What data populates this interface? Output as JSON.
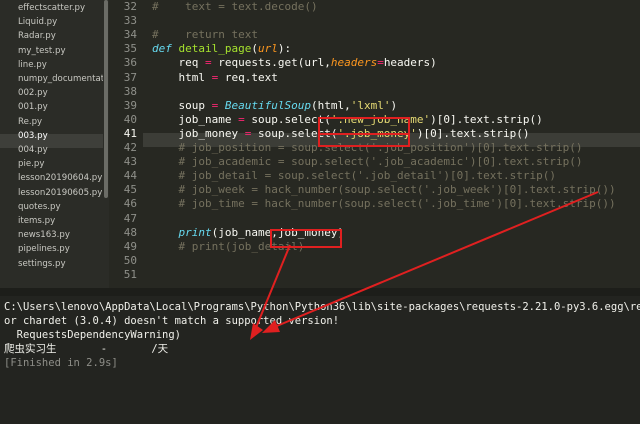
{
  "sidebar": {
    "files": [
      "effectscatter.py",
      "Liquid.py",
      "Radar.py",
      "my_test.py",
      "line.py",
      "numpy_documentatio",
      "002.py",
      "001.py",
      "Re.py",
      "003.py",
      "004.py",
      "pie.py",
      "lesson20190604.py",
      "lesson20190605.py",
      "quotes.py",
      "items.py",
      "news163.py",
      "pipelines.py",
      "settings.py"
    ],
    "selected": "003.py"
  },
  "editor": {
    "current_line": "41",
    "lines": [
      {
        "n": "32",
        "t": "#    text = text.decode()"
      },
      {
        "n": "33",
        "t": ""
      },
      {
        "n": "34",
        "t": "#    return text"
      },
      {
        "n": "35",
        "t": "def detail_page(url):"
      },
      {
        "n": "36",
        "t": "    req = requests.get(url,headers=headers)"
      },
      {
        "n": "37",
        "t": "    html = req.text"
      },
      {
        "n": "38",
        "t": ""
      },
      {
        "n": "39",
        "t": "    soup = BeautifulSoup(html,'lxml')"
      },
      {
        "n": "40",
        "t": "    job_name = soup.select('.new_job_name')[0].text.strip()"
      },
      {
        "n": "41",
        "t": "    job_money = soup.select('.job_money')[0].text.strip()"
      },
      {
        "n": "42",
        "t": "    # job_position = soup.select('.job_position')[0].text.strip()"
      },
      {
        "n": "43",
        "t": "    # job_academic = soup.select('.job_academic')[0].text.strip()"
      },
      {
        "n": "44",
        "t": "    # job_detail = soup.select('.job_detail')[0].text.strip()"
      },
      {
        "n": "45",
        "t": "    # job_week = hack_number(soup.select('.job_week')[0].text.strip())"
      },
      {
        "n": "46",
        "t": "    # job_time = hack_number(soup.select('.job_time')[0].text.strip())"
      },
      {
        "n": "47",
        "t": ""
      },
      {
        "n": "48",
        "t": "    print(job_name,job_money)"
      },
      {
        "n": "49",
        "t": "    # print(job_detail)"
      },
      {
        "n": "50",
        "t": ""
      },
      {
        "n": "51",
        "t": ""
      }
    ]
  },
  "output": {
    "lines": [
      "C:\\Users\\lenovo\\AppData\\Local\\Programs\\Python\\Python36\\lib\\site-packages\\requests-2.21.0-py3.6.egg\\requ",
      "or chardet (3.0.4) doesn't match a supported version!",
      "  RequestsDependencyWarning)",
      "爬虫实习生       -       /天",
      "[Finished in 2.9s]"
    ]
  },
  "colors": {
    "background": "#272822",
    "keyword": "#66d9ef",
    "function": "#a6e22e",
    "string": "#e6db74",
    "operator": "#f92672",
    "comment": "#75715e",
    "annotation": "#e02020"
  }
}
